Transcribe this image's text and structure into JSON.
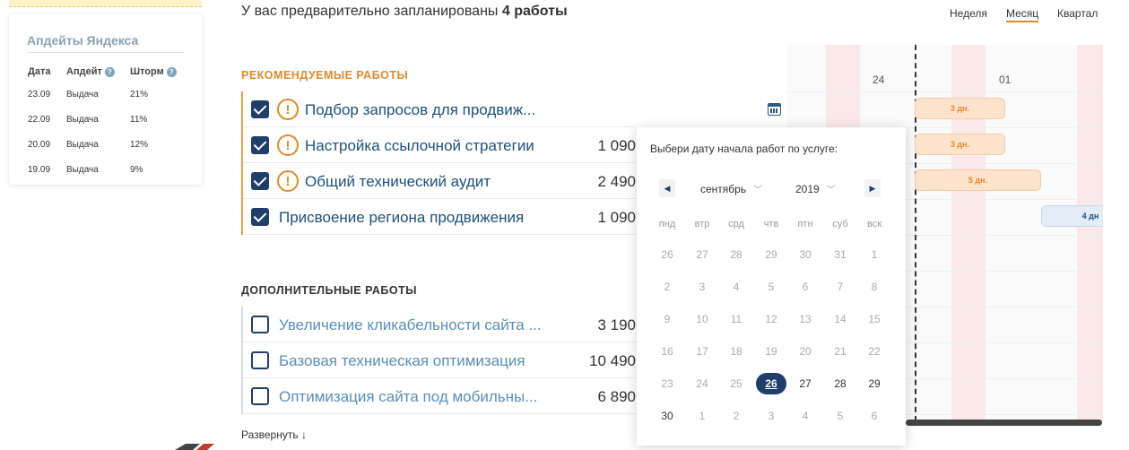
{
  "sidebar": {
    "title": "Апдейты Яндекса",
    "columns": [
      "Дата",
      "Апдейт",
      "Шторм"
    ],
    "rows": [
      {
        "date": "23.09",
        "update": "Выдача",
        "storm": "21%"
      },
      {
        "date": "22.09",
        "update": "Выдача",
        "storm": "11%"
      },
      {
        "date": "20.09",
        "update": "Выдача",
        "storm": "12%"
      },
      {
        "date": "19.09",
        "update": "Выдача",
        "storm": "9%"
      }
    ]
  },
  "header": {
    "planned_prefix": "У вас предварительно запланированы ",
    "planned_count": "4 работы",
    "periods": [
      {
        "label": "Неделя",
        "active": false
      },
      {
        "label": "Месяц",
        "active": true
      },
      {
        "label": "Квартал",
        "active": false
      }
    ]
  },
  "recommended": {
    "title": "РЕКОМЕНДУЕМЫЕ РАБОТЫ",
    "tasks": [
      {
        "name": "Подбор запросов для продвиж...",
        "price": "",
        "checked": true,
        "warning": true
      },
      {
        "name": "Настройка ссылочной стратегии",
        "price": "1 090",
        "checked": true,
        "warning": true
      },
      {
        "name": "Общий технический аудит",
        "price": "2 490",
        "checked": true,
        "warning": true
      },
      {
        "name": "Присвоение региона продвижения",
        "price": "1 090",
        "checked": true,
        "warning": false
      }
    ]
  },
  "additional": {
    "title": "ДОПОЛНИТЕЛЬНЫЕ РАБОТЫ",
    "tasks": [
      {
        "name": "Увеличение кликабельности сайта ...",
        "price": "3 190",
        "checked": false
      },
      {
        "name": "Базовая техническая оптимизация",
        "price": "10 490",
        "checked": false
      },
      {
        "name": "Оптимизация сайта под мобильны...",
        "price": "6 890",
        "checked": false
      }
    ],
    "expand_label": "Развернуть ↓"
  },
  "gantt": {
    "days": [
      "24",
      "01"
    ],
    "bars": [
      {
        "label": "3 дн.",
        "color": "orange"
      },
      {
        "label": "3 дн.",
        "color": "orange"
      },
      {
        "label": "5 дн.",
        "color": "orange"
      },
      {
        "label": "4 дн",
        "color": "blue"
      }
    ]
  },
  "datepicker": {
    "title": "Выбери дату начала работ по услуге:",
    "month": "сентябрь",
    "year": "2019",
    "weekdays": [
      "пнд",
      "втр",
      "срд",
      "чтв",
      "птн",
      "суб",
      "вск"
    ],
    "weeks": [
      [
        "26",
        "27",
        "28",
        "29",
        "30",
        "31",
        "1"
      ],
      [
        "2",
        "3",
        "4",
        "5",
        "6",
        "7",
        "8"
      ],
      [
        "9",
        "10",
        "11",
        "12",
        "13",
        "14",
        "15"
      ],
      [
        "16",
        "17",
        "18",
        "19",
        "20",
        "21",
        "22"
      ],
      [
        "23",
        "24",
        "25",
        "26",
        "27",
        "28",
        "29"
      ],
      [
        "30",
        "1",
        "2",
        "3",
        "4",
        "5",
        "6"
      ]
    ],
    "selected": "26",
    "enabled_days": [
      "26",
      "27",
      "28",
      "29",
      "30"
    ]
  },
  "colors": {
    "accent": "#e08a2a",
    "primary": "#1f3f6a",
    "link": "#1d4f7a"
  }
}
